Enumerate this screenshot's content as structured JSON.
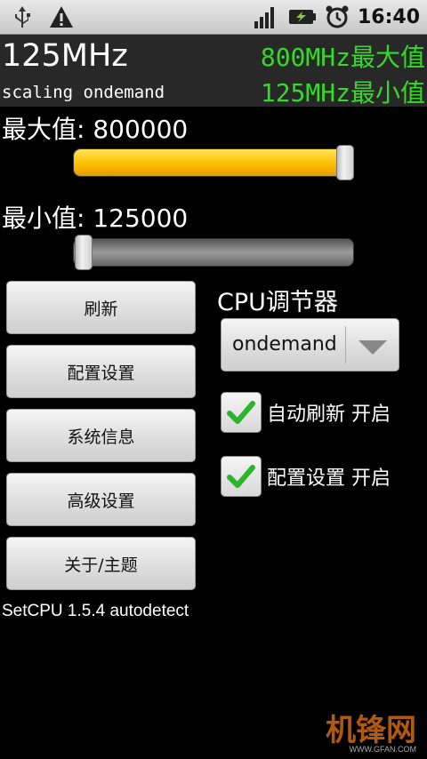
{
  "status_bar": {
    "time": "16:40",
    "icons": [
      "usb-icon",
      "warning-icon",
      "signal-icon",
      "battery-charging-icon",
      "alarm-clock-icon"
    ]
  },
  "header": {
    "current_freq": "125MHz",
    "governor_line": "scaling ondemand",
    "max_label": "800MHz最大值",
    "min_label": "125MHz最小值"
  },
  "max_slider": {
    "label": "最大值: 800000",
    "value_fraction": 1.0
  },
  "min_slider": {
    "label": "最小值: 125000",
    "value_fraction": 0.0
  },
  "buttons": {
    "refresh": "刷新",
    "profiles": "配置设置",
    "system_info": "系统信息",
    "advanced": "高级设置",
    "about": "关于/主题"
  },
  "governor": {
    "title": "CPU调节器",
    "selected": "ondemand"
  },
  "checkboxes": {
    "auto_refresh": {
      "label": "自动刷新 开启",
      "checked": true
    },
    "profiles": {
      "label": "配置设置 开启",
      "checked": true
    }
  },
  "version": "SetCPU 1.5.4 autodetect",
  "watermark": {
    "logo_text": "机锋网",
    "url": "WWW.GFAN.COM"
  },
  "colors": {
    "accent_green": "#36d82a",
    "slider_fill": "#ffbf00"
  }
}
